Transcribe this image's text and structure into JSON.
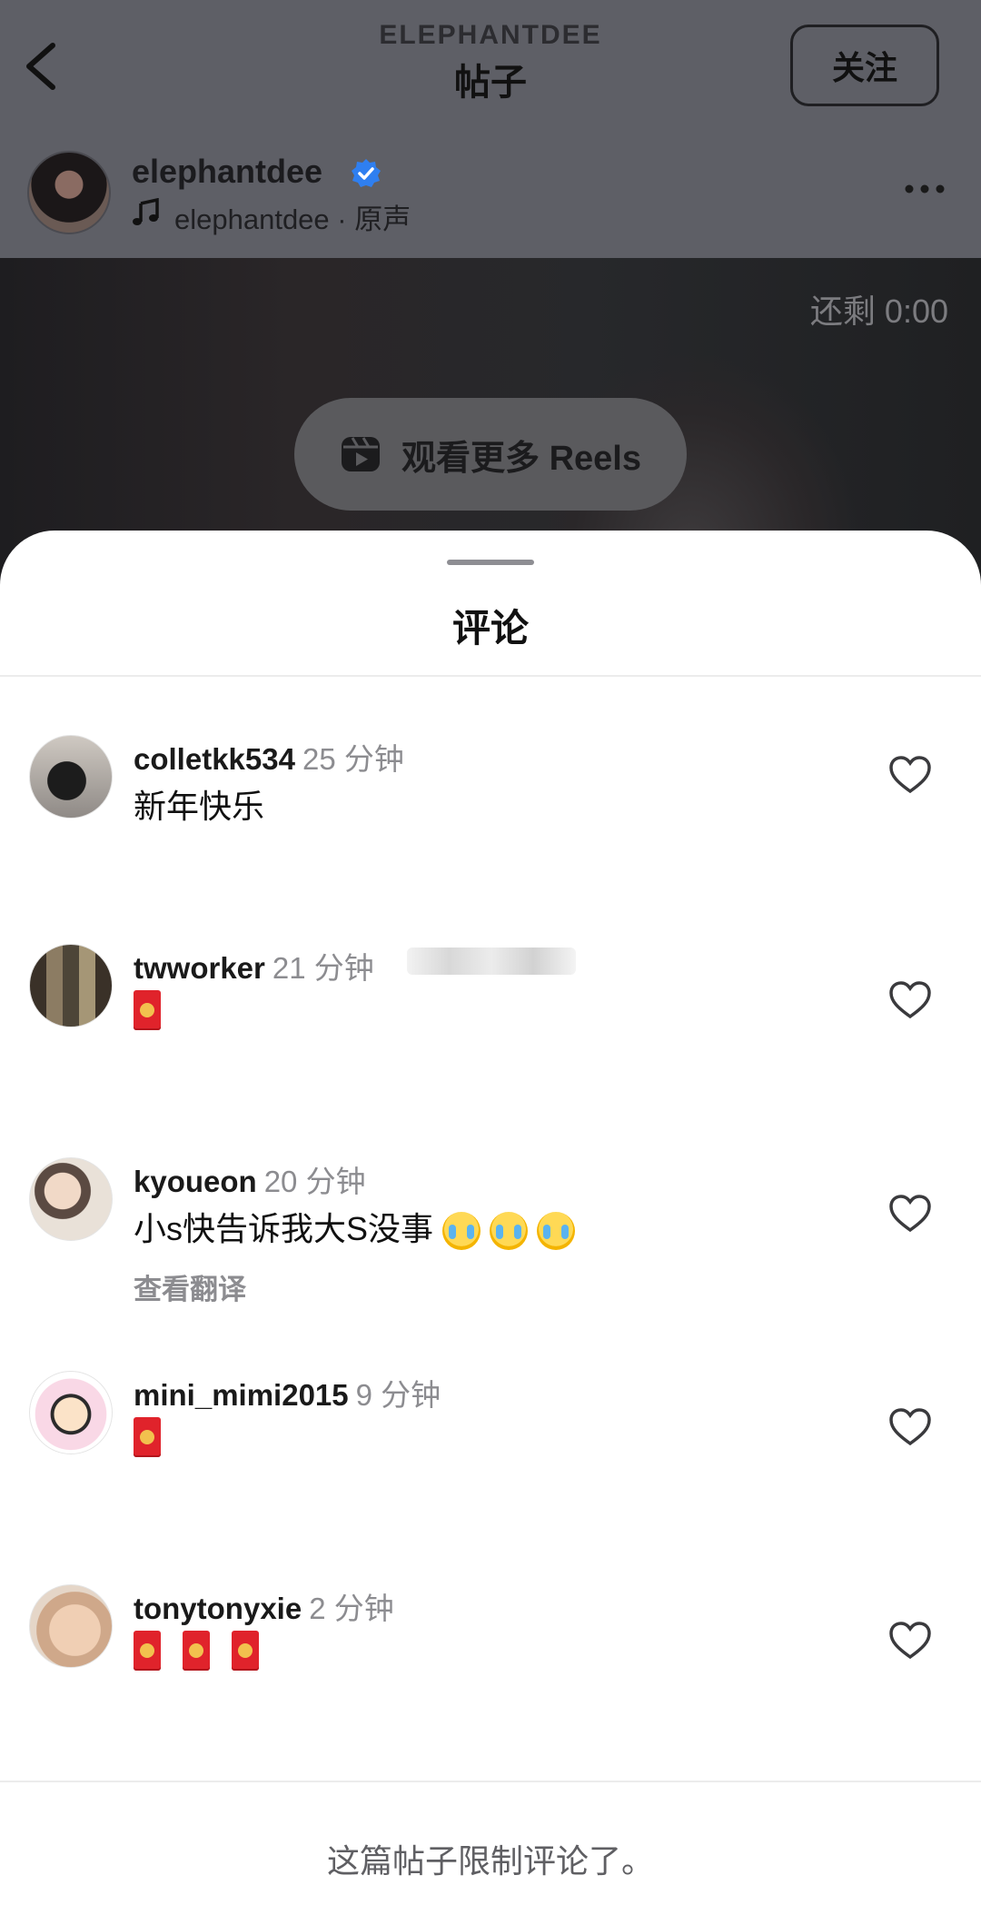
{
  "header": {
    "handle": "ELEPHANTDEE",
    "title": "帖子",
    "follow_label": "关注"
  },
  "author": {
    "name": "elephantdee",
    "audio": "elephantdee · 原声",
    "verified_color": "#2f7ff0"
  },
  "video": {
    "remaining": "还剩 0:00",
    "reels_label": "观看更多 Reels"
  },
  "sheet": {
    "title": "评论",
    "footer": "这篇帖子限制评论了。"
  },
  "comments": [
    {
      "user": "colletkk534",
      "time": "25 分钟",
      "text": "新年快乐"
    },
    {
      "user": "twworker",
      "time": "21 分钟",
      "text": "",
      "emoji": "red-envelope"
    },
    {
      "user": "kyoueon",
      "time": "20 分钟",
      "text": "小s快告诉我大S没事",
      "emoji": "crying-face x3",
      "translate": "查看翻译"
    },
    {
      "user": "mini_mimi2015",
      "time": "9 分钟",
      "text": "",
      "emoji": "red-envelope"
    },
    {
      "user": "tonytonyxie",
      "time": "2 分钟",
      "text": "",
      "emoji": "red-envelope x3"
    }
  ]
}
